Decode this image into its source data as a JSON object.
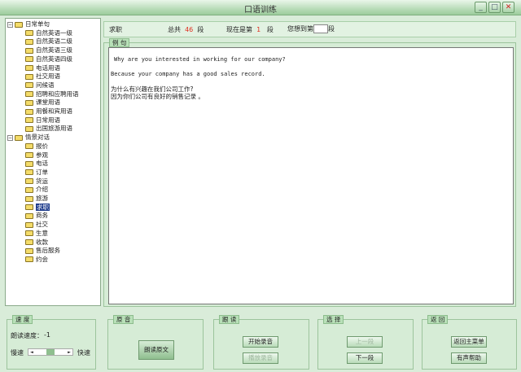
{
  "window": {
    "title": "口语训练"
  },
  "tree": {
    "groups": [
      {
        "label": "日常单句",
        "children": [
          "自然英语一级",
          "自然英语二级",
          "自然英语三级",
          "自然英语四级",
          "电话用语",
          "社交用语",
          "问候语",
          "招聘和应聘用语",
          "课堂用语",
          "用餐和宾用语",
          "日常用语",
          "出国旅游用语"
        ]
      },
      {
        "label": "情景对话",
        "children": [
          "报价",
          "参观",
          "电话",
          "订单",
          "货运",
          "介绍",
          "旅游",
          "求职",
          "商务",
          "社交",
          "生意",
          "收款",
          "售后服务",
          "约会"
        ]
      }
    ],
    "selected": "求职"
  },
  "header": {
    "topic": "求职",
    "total_prefix": "总共",
    "total": "46",
    "unit": "段",
    "current_prefix": "现在是第",
    "current": "1",
    "goto_prefix": "您想到第",
    "goto_value": ""
  },
  "example": {
    "label": "例 句",
    "lines": [
      "Why are you interested in working for our company?",
      "Because your company has a good sales record.",
      "为什么有兴趣在我们公司工作?",
      "因为你们公司有良好的销售记录 。"
    ]
  },
  "speed": {
    "label": "速 度",
    "reading_speed_label": "朗读速度：",
    "reading_speed": "-1",
    "slow": "慢速",
    "fast": "快速",
    "slider_fraction": 0.5
  },
  "original": {
    "label": "原 音",
    "read_button": "朗读原文"
  },
  "follow": {
    "label": "跟 读",
    "start_record": "开始录音",
    "play_record": "播放录音"
  },
  "select": {
    "label": "选 择",
    "prev": "上一段",
    "next": "下一段"
  },
  "back": {
    "label": "返 回",
    "main_menu": "返回主菜单",
    "voice_help": "有声帮助"
  },
  "colors": {
    "accent": "#e03020",
    "selection": "#1e3c8c"
  }
}
